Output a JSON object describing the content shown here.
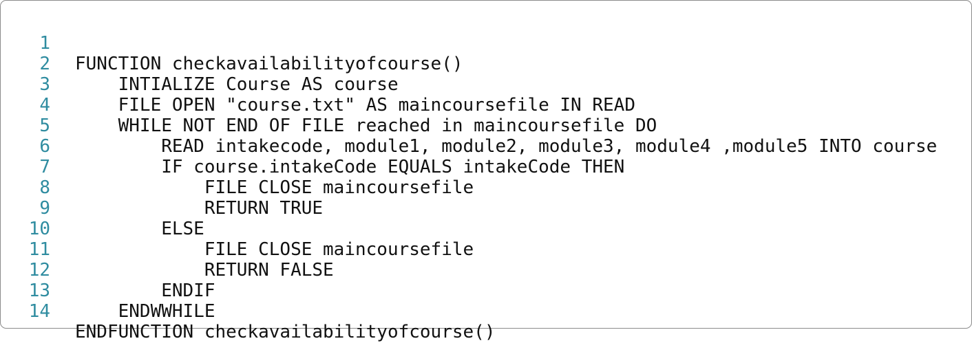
{
  "code": {
    "lines": [
      {
        "num": "1",
        "text": "FUNCTION checkavailabilityofcourse()"
      },
      {
        "num": "2",
        "text": "    INTIALIZE Course AS course"
      },
      {
        "num": "3",
        "text": "    FILE OPEN \"course.txt\" AS maincoursefile IN READ"
      },
      {
        "num": "4",
        "text": "    WHILE NOT END OF FILE reached in maincoursefile DO"
      },
      {
        "num": "5",
        "text": "        READ intakecode, module1, module2, module3, module4 ,module5 INTO course"
      },
      {
        "num": "6",
        "text": "        IF course.intakeCode EQUALS intakeCode THEN"
      },
      {
        "num": "7",
        "text": "            FILE CLOSE maincoursefile"
      },
      {
        "num": "8",
        "text": "            RETURN TRUE"
      },
      {
        "num": "9",
        "text": "        ELSE"
      },
      {
        "num": "10",
        "text": "            FILE CLOSE maincoursefile"
      },
      {
        "num": "11",
        "text": "            RETURN FALSE"
      },
      {
        "num": "12",
        "text": "        ENDIF"
      },
      {
        "num": "13",
        "text": "    ENDWWHILE"
      },
      {
        "num": "14",
        "text": "ENDFUNCTION checkavailabilityofcourse()"
      }
    ]
  }
}
